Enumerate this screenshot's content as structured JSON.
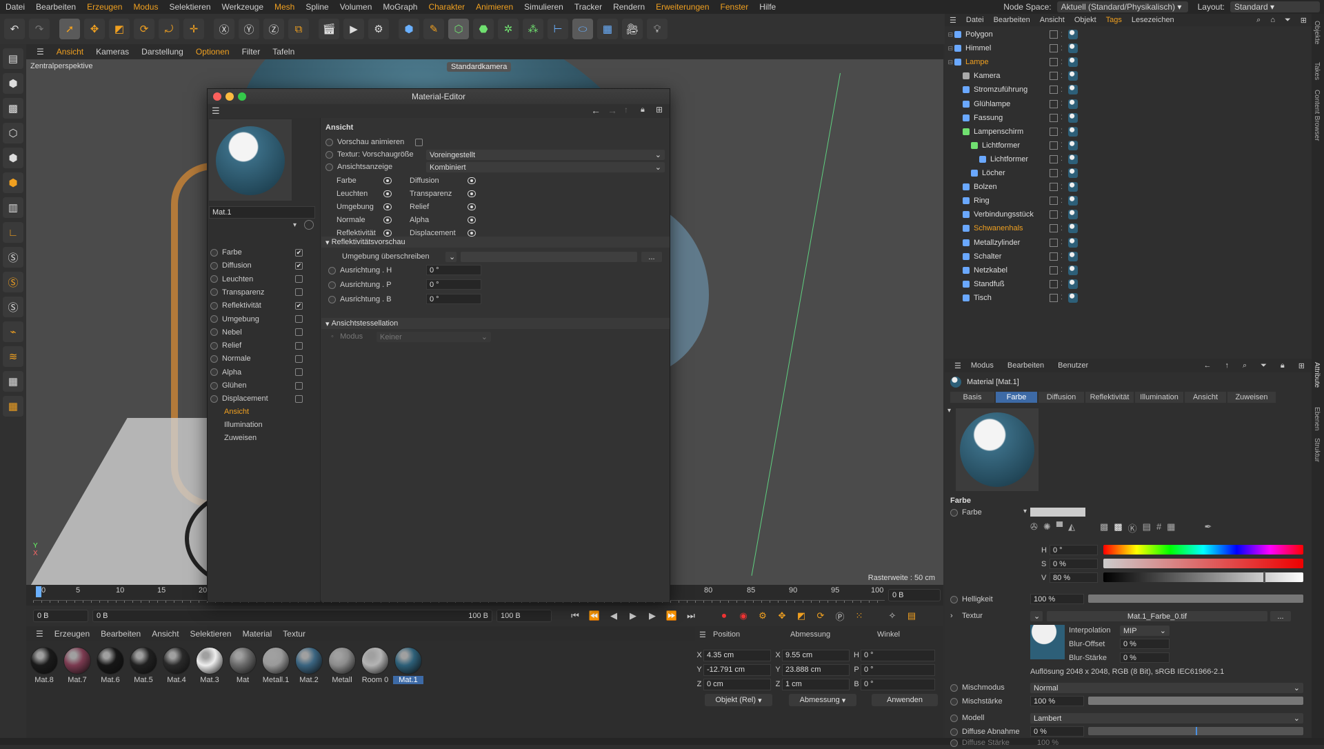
{
  "menu": [
    "Datei",
    "Bearbeiten",
    "Erzeugen",
    "Modus",
    "Selektieren",
    "Werkzeuge",
    "Mesh",
    "Spline",
    "Volumen",
    "MoGraph",
    "Charakter",
    "Animieren",
    "Simulieren",
    "Tracker",
    "Rendern",
    "Erweiterungen",
    "Fenster",
    "Hilfe"
  ],
  "node_space": {
    "label": "Node Space:",
    "value": "Aktuell (Standard/Physikalisch)"
  },
  "layout": {
    "label": "Layout:",
    "value": "Standard"
  },
  "toolbar_icons": [
    "undo-icon",
    "redo-icon",
    "cursor-icon",
    "move-icon",
    "scale-icon",
    "rotate-icon",
    "recent-tool-icon",
    "axis-x-icon",
    "axis-y-icon",
    "axis-z-icon",
    "coordinate-icon",
    "render-region-icon",
    "render-view-icon",
    "render-settings-icon",
    "cube-icon",
    "pen-icon",
    "subdivision-icon",
    "extrude-icon",
    "array-icon",
    "cloner-icon",
    "deformer-icon",
    "spline-icon",
    "floor-icon",
    "camera-icon",
    "light-icon"
  ],
  "viewport": {
    "menu": [
      "Ansicht",
      "Kameras",
      "Darstellung",
      "Optionen",
      "Filter",
      "Tafeln"
    ],
    "label": "Zentralperspektive",
    "camera": "Standardkamera",
    "raster": "Rasterweite : 50 cm"
  },
  "timeline": {
    "ticks": [
      "0",
      "5",
      "10",
      "15",
      "20",
      "80",
      "85",
      "90",
      "95",
      "100"
    ],
    "frame_left": "0 B",
    "frame_start": "0 B",
    "frame_end": "100 B",
    "frame_end2": "100 B",
    "frame_right": "0 B"
  },
  "material_manager": {
    "menu": [
      "Erzeugen",
      "Bearbeiten",
      "Ansicht",
      "Selektieren",
      "Material",
      "Textur"
    ],
    "materials": [
      {
        "name": "Mat.8",
        "color": "#1a1a1a"
      },
      {
        "name": "Mat.7",
        "color": "#7b3a50"
      },
      {
        "name": "Mat.6",
        "color": "#161616"
      },
      {
        "name": "Mat.5",
        "color": "#202020"
      },
      {
        "name": "Mat.4",
        "color": "#2a2a2a"
      },
      {
        "name": "Mat.3",
        "color": "#eeeeee"
      },
      {
        "name": "Mat",
        "color": "#6a6a6a"
      },
      {
        "name": "Metall.1",
        "color": "#9a9a9a"
      },
      {
        "name": "Mat.2",
        "color": "#3a6480"
      },
      {
        "name": "Metall",
        "color": "#8c8c8c"
      },
      {
        "name": "Room 0",
        "color": "#b4b4b4"
      },
      {
        "name": "Mat.1",
        "color": "#2d5f78",
        "selected": true
      }
    ]
  },
  "coords": {
    "headers": [
      "Position",
      "Abmessung",
      "Winkel"
    ],
    "rows": [
      {
        "axis": "X",
        "pos": "4.35 cm",
        "dimaxis": "X",
        "dim": "9.55 cm",
        "angaxis": "H",
        "ang": "0 °"
      },
      {
        "axis": "Y",
        "pos": "-12.791 cm",
        "dimaxis": "Y",
        "dim": "23.888 cm",
        "angaxis": "P",
        "ang": "0 °"
      },
      {
        "axis": "Z",
        "pos": "0 cm",
        "dimaxis": "Z",
        "dim": "1 cm",
        "angaxis": "B",
        "ang": "0 °"
      }
    ],
    "mode": "Objekt (Rel)",
    "size_mode": "Abmessung",
    "apply": "Anwenden"
  },
  "material_editor": {
    "title": "Material-Editor",
    "name": "Mat.1",
    "channels": [
      {
        "label": "Farbe",
        "checked": true
      },
      {
        "label": "Diffusion",
        "checked": true
      },
      {
        "label": "Leuchten",
        "checked": false
      },
      {
        "label": "Transparenz",
        "checked": false
      },
      {
        "label": "Reflektivität",
        "checked": true
      },
      {
        "label": "Umgebung",
        "checked": false
      },
      {
        "label": "Nebel",
        "checked": false
      },
      {
        "label": "Relief",
        "checked": false
      },
      {
        "label": "Normale",
        "checked": false
      },
      {
        "label": "Alpha",
        "checked": false
      },
      {
        "label": "Glühen",
        "checked": false
      },
      {
        "label": "Displacement",
        "checked": false
      }
    ],
    "links": [
      {
        "label": "Ansicht",
        "active": true
      },
      {
        "label": "Illumination",
        "active": false
      },
      {
        "label": "Zuweisen",
        "active": false
      }
    ],
    "section_title": "Ansicht",
    "animate_preview": "Vorschau animieren",
    "tex_preview_label": "Textur: Vorschaugröße",
    "tex_preview_value": "Voreingestellt",
    "view_display_label": "Ansichtsanzeige",
    "view_display_value": "Kombiniert",
    "eye_left": [
      "Farbe",
      "Leuchten",
      "Umgebung",
      "Normale",
      "Reflektivität"
    ],
    "eye_right": [
      "Diffusion",
      "Transparenz",
      "Relief",
      "Alpha",
      "Displacement"
    ],
    "refl_section": "Reflektivitätsvorschau",
    "env_override": "Umgebung überschreiben",
    "env_btn": "...",
    "orient": [
      {
        "label": "Ausrichtung . H",
        "value": "0 °"
      },
      {
        "label": "Ausrichtung . P",
        "value": "0 °"
      },
      {
        "label": "Ausrichtung . B",
        "value": "0 °"
      }
    ],
    "tess_section": "Ansichtstessellation",
    "mode_label": "Modus",
    "mode_value": "Keiner"
  },
  "object_manager": {
    "menu": [
      "Datei",
      "Bearbeiten",
      "Ansicht",
      "Objekt",
      "Tags",
      "Lesezeichen"
    ],
    "objects": [
      {
        "name": "Polygon",
        "indent": 0,
        "color": "#6aa8ff"
      },
      {
        "name": "Himmel",
        "indent": 0,
        "color": "#6aa8ff"
      },
      {
        "name": "Lampe",
        "indent": 0,
        "color": "#6aa8ff",
        "orange": true
      },
      {
        "name": "Kamera",
        "indent": 1,
        "color": "#aaaaaa"
      },
      {
        "name": "Stromzuführung",
        "indent": 1,
        "color": "#6aa8ff"
      },
      {
        "name": "Glühlampe",
        "indent": 1,
        "color": "#6aa8ff"
      },
      {
        "name": "Fassung",
        "indent": 1,
        "color": "#6aa8ff"
      },
      {
        "name": "Lampenschirm",
        "indent": 1,
        "color": "#70e070"
      },
      {
        "name": "Lichtformer",
        "indent": 2,
        "color": "#70e070"
      },
      {
        "name": "Lichtformer",
        "indent": 3,
        "color": "#6aa8ff"
      },
      {
        "name": "Löcher",
        "indent": 2,
        "color": "#6aa8ff"
      },
      {
        "name": "Bolzen",
        "indent": 1,
        "color": "#6aa8ff"
      },
      {
        "name": "Ring",
        "indent": 1,
        "color": "#6aa8ff"
      },
      {
        "name": "Verbindungsstück",
        "indent": 1,
        "color": "#6aa8ff"
      },
      {
        "name": "Schwanenhals",
        "indent": 1,
        "color": "#6aa8ff",
        "orange": true
      },
      {
        "name": "Metallzylinder",
        "indent": 1,
        "color": "#6aa8ff"
      },
      {
        "name": "Schalter",
        "indent": 1,
        "color": "#6aa8ff"
      },
      {
        "name": "Netzkabel",
        "indent": 1,
        "color": "#6aa8ff"
      },
      {
        "name": "Standfuß",
        "indent": 1,
        "color": "#6aa8ff"
      },
      {
        "name": "Tisch",
        "indent": 1,
        "color": "#6aa8ff"
      }
    ]
  },
  "side_tabs": [
    "Objekte",
    "Takes",
    "Content Browser",
    "Attribute",
    "Ebenen",
    "Struktur"
  ],
  "attributes": {
    "menu": [
      "Modus",
      "Bearbeiten",
      "Benutzer"
    ],
    "title": "Material [Mat.1]",
    "tabs": [
      {
        "label": "Basis",
        "active": false
      },
      {
        "label": "Farbe",
        "active": true
      },
      {
        "label": "Diffusion",
        "active": false
      },
      {
        "label": "Reflektivität",
        "active": false
      },
      {
        "label": "Illumination",
        "active": false
      },
      {
        "label": "Ansicht",
        "active": false
      },
      {
        "label": "Zuweisen",
        "active": false
      }
    ],
    "section": "Farbe",
    "color_label": "Farbe",
    "h": {
      "label": "H",
      "value": "0 °"
    },
    "s": {
      "label": "S",
      "value": "0 %"
    },
    "v": {
      "label": "V",
      "value": "80 %",
      "fraction": 0.8
    },
    "brightness": {
      "label": "Helligkeit",
      "value": "100 %",
      "fraction": 1.0
    },
    "texture_label": "Textur",
    "texture_file": "Mat.1_Farbe_0.tif",
    "texture_btn": "...",
    "interp_label": "Interpolation",
    "interp_value": "MIP",
    "blur_offset_label": "Blur-Offset",
    "blur_offset_value": "0 %",
    "blur_strength_label": "Blur-Stärke",
    "blur_strength_value": "0 %",
    "resolution": "Auflösung 2048 x 2048, RGB (8 Bit), sRGB IEC61966-2.1",
    "blend_label": "Mischmodus",
    "blend_value": "Normal",
    "blend_strength_label": "Mischstärke",
    "blend_strength_value": "100 %",
    "model_label": "Modell",
    "model_value": "Lambert",
    "diffuse_falloff_label": "Diffuse Abnahme",
    "diffuse_falloff_value": "0 %",
    "diffuse_falloff_fraction": 0.5,
    "diffuse_strength_label": "Diffuse Stärke",
    "diffuse_strength_value": "100 %"
  },
  "colors": {
    "accent": "#f0a020",
    "selection": "#3d6aa6"
  }
}
